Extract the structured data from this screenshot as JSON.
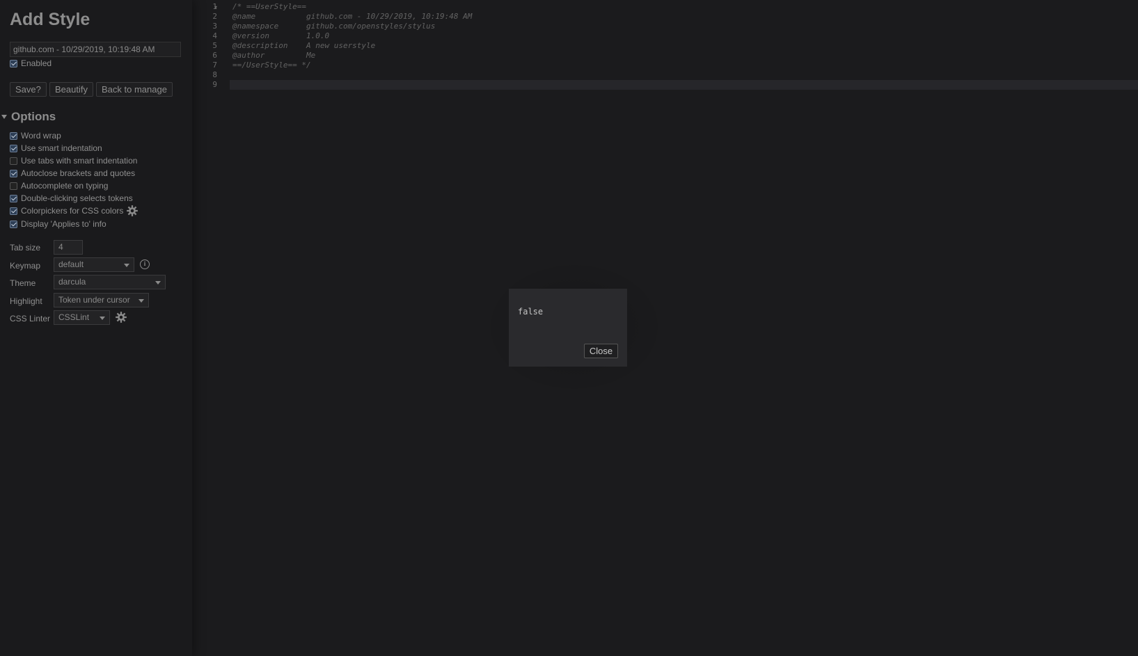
{
  "sidebar": {
    "title": "Add Style",
    "style_name_value": "github.com - 10/29/2019, 10:19:48 AM",
    "enabled_label": "Enabled",
    "enabled_checked": true,
    "buttons": {
      "save": "Save?",
      "beautify": "Beautify",
      "back": "Back to manage"
    },
    "options_title": "Options",
    "options": [
      {
        "label": "Word wrap",
        "checked": true
      },
      {
        "label": "Use smart indentation",
        "checked": true
      },
      {
        "label": "Use tabs with smart indentation",
        "checked": false
      },
      {
        "label": "Autoclose brackets and quotes",
        "checked": true
      },
      {
        "label": "Autocomplete on typing",
        "checked": false
      },
      {
        "label": "Double-clicking selects tokens",
        "checked": true
      },
      {
        "label": "Colorpickers for CSS colors",
        "checked": true
      },
      {
        "label": "Display 'Applies to' info",
        "checked": true
      }
    ],
    "settings": {
      "tab_size_label": "Tab size",
      "tab_size_value": "4",
      "keymap_label": "Keymap",
      "keymap_value": "default",
      "theme_label": "Theme",
      "theme_value": "darcula",
      "highlight_label": "Highlight",
      "highlight_value": "Token under cursor",
      "linter_label": "CSS Linter",
      "linter_value": "CSSLint"
    }
  },
  "editor": {
    "line_numbers": [
      "1",
      "2",
      "3",
      "4",
      "5",
      "6",
      "7",
      "8",
      "9"
    ],
    "lines": [
      "/* ==UserStyle==",
      "@name           github.com - 10/29/2019, 10:19:48 AM",
      "@namespace      github.com/openstyles/stylus",
      "@version        1.0.0",
      "@description    A new userstyle",
      "@author         Me",
      "==/UserStyle== */",
      "",
      ""
    ]
  },
  "dialog": {
    "message": "false",
    "close_label": "Close"
  },
  "icons": {
    "gear": "gear-icon",
    "info": "info-icon",
    "fold": "fold-arrow-icon",
    "dropdown": "chevron-down-icon"
  }
}
